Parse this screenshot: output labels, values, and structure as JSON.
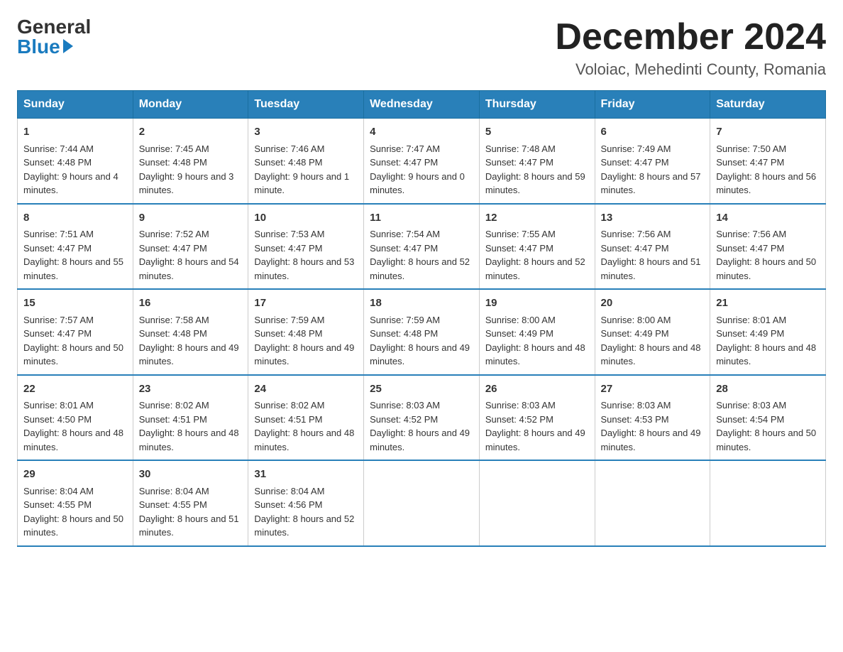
{
  "logo": {
    "general": "General",
    "blue": "Blue"
  },
  "title": "December 2024",
  "location": "Voloiac, Mehedinti County, Romania",
  "days_of_week": [
    "Sunday",
    "Monday",
    "Tuesday",
    "Wednesday",
    "Thursday",
    "Friday",
    "Saturday"
  ],
  "weeks": [
    [
      {
        "day": "1",
        "sunrise": "7:44 AM",
        "sunset": "4:48 PM",
        "daylight": "9 hours and 4 minutes."
      },
      {
        "day": "2",
        "sunrise": "7:45 AM",
        "sunset": "4:48 PM",
        "daylight": "9 hours and 3 minutes."
      },
      {
        "day": "3",
        "sunrise": "7:46 AM",
        "sunset": "4:48 PM",
        "daylight": "9 hours and 1 minute."
      },
      {
        "day": "4",
        "sunrise": "7:47 AM",
        "sunset": "4:47 PM",
        "daylight": "9 hours and 0 minutes."
      },
      {
        "day": "5",
        "sunrise": "7:48 AM",
        "sunset": "4:47 PM",
        "daylight": "8 hours and 59 minutes."
      },
      {
        "day": "6",
        "sunrise": "7:49 AM",
        "sunset": "4:47 PM",
        "daylight": "8 hours and 57 minutes."
      },
      {
        "day": "7",
        "sunrise": "7:50 AM",
        "sunset": "4:47 PM",
        "daylight": "8 hours and 56 minutes."
      }
    ],
    [
      {
        "day": "8",
        "sunrise": "7:51 AM",
        "sunset": "4:47 PM",
        "daylight": "8 hours and 55 minutes."
      },
      {
        "day": "9",
        "sunrise": "7:52 AM",
        "sunset": "4:47 PM",
        "daylight": "8 hours and 54 minutes."
      },
      {
        "day": "10",
        "sunrise": "7:53 AM",
        "sunset": "4:47 PM",
        "daylight": "8 hours and 53 minutes."
      },
      {
        "day": "11",
        "sunrise": "7:54 AM",
        "sunset": "4:47 PM",
        "daylight": "8 hours and 52 minutes."
      },
      {
        "day": "12",
        "sunrise": "7:55 AM",
        "sunset": "4:47 PM",
        "daylight": "8 hours and 52 minutes."
      },
      {
        "day": "13",
        "sunrise": "7:56 AM",
        "sunset": "4:47 PM",
        "daylight": "8 hours and 51 minutes."
      },
      {
        "day": "14",
        "sunrise": "7:56 AM",
        "sunset": "4:47 PM",
        "daylight": "8 hours and 50 minutes."
      }
    ],
    [
      {
        "day": "15",
        "sunrise": "7:57 AM",
        "sunset": "4:47 PM",
        "daylight": "8 hours and 50 minutes."
      },
      {
        "day": "16",
        "sunrise": "7:58 AM",
        "sunset": "4:48 PM",
        "daylight": "8 hours and 49 minutes."
      },
      {
        "day": "17",
        "sunrise": "7:59 AM",
        "sunset": "4:48 PM",
        "daylight": "8 hours and 49 minutes."
      },
      {
        "day": "18",
        "sunrise": "7:59 AM",
        "sunset": "4:48 PM",
        "daylight": "8 hours and 49 minutes."
      },
      {
        "day": "19",
        "sunrise": "8:00 AM",
        "sunset": "4:49 PM",
        "daylight": "8 hours and 48 minutes."
      },
      {
        "day": "20",
        "sunrise": "8:00 AM",
        "sunset": "4:49 PM",
        "daylight": "8 hours and 48 minutes."
      },
      {
        "day": "21",
        "sunrise": "8:01 AM",
        "sunset": "4:49 PM",
        "daylight": "8 hours and 48 minutes."
      }
    ],
    [
      {
        "day": "22",
        "sunrise": "8:01 AM",
        "sunset": "4:50 PM",
        "daylight": "8 hours and 48 minutes."
      },
      {
        "day": "23",
        "sunrise": "8:02 AM",
        "sunset": "4:51 PM",
        "daylight": "8 hours and 48 minutes."
      },
      {
        "day": "24",
        "sunrise": "8:02 AM",
        "sunset": "4:51 PM",
        "daylight": "8 hours and 48 minutes."
      },
      {
        "day": "25",
        "sunrise": "8:03 AM",
        "sunset": "4:52 PM",
        "daylight": "8 hours and 49 minutes."
      },
      {
        "day": "26",
        "sunrise": "8:03 AM",
        "sunset": "4:52 PM",
        "daylight": "8 hours and 49 minutes."
      },
      {
        "day": "27",
        "sunrise": "8:03 AM",
        "sunset": "4:53 PM",
        "daylight": "8 hours and 49 minutes."
      },
      {
        "day": "28",
        "sunrise": "8:03 AM",
        "sunset": "4:54 PM",
        "daylight": "8 hours and 50 minutes."
      }
    ],
    [
      {
        "day": "29",
        "sunrise": "8:04 AM",
        "sunset": "4:55 PM",
        "daylight": "8 hours and 50 minutes."
      },
      {
        "day": "30",
        "sunrise": "8:04 AM",
        "sunset": "4:55 PM",
        "daylight": "8 hours and 51 minutes."
      },
      {
        "day": "31",
        "sunrise": "8:04 AM",
        "sunset": "4:56 PM",
        "daylight": "8 hours and 52 minutes."
      },
      null,
      null,
      null,
      null
    ]
  ]
}
